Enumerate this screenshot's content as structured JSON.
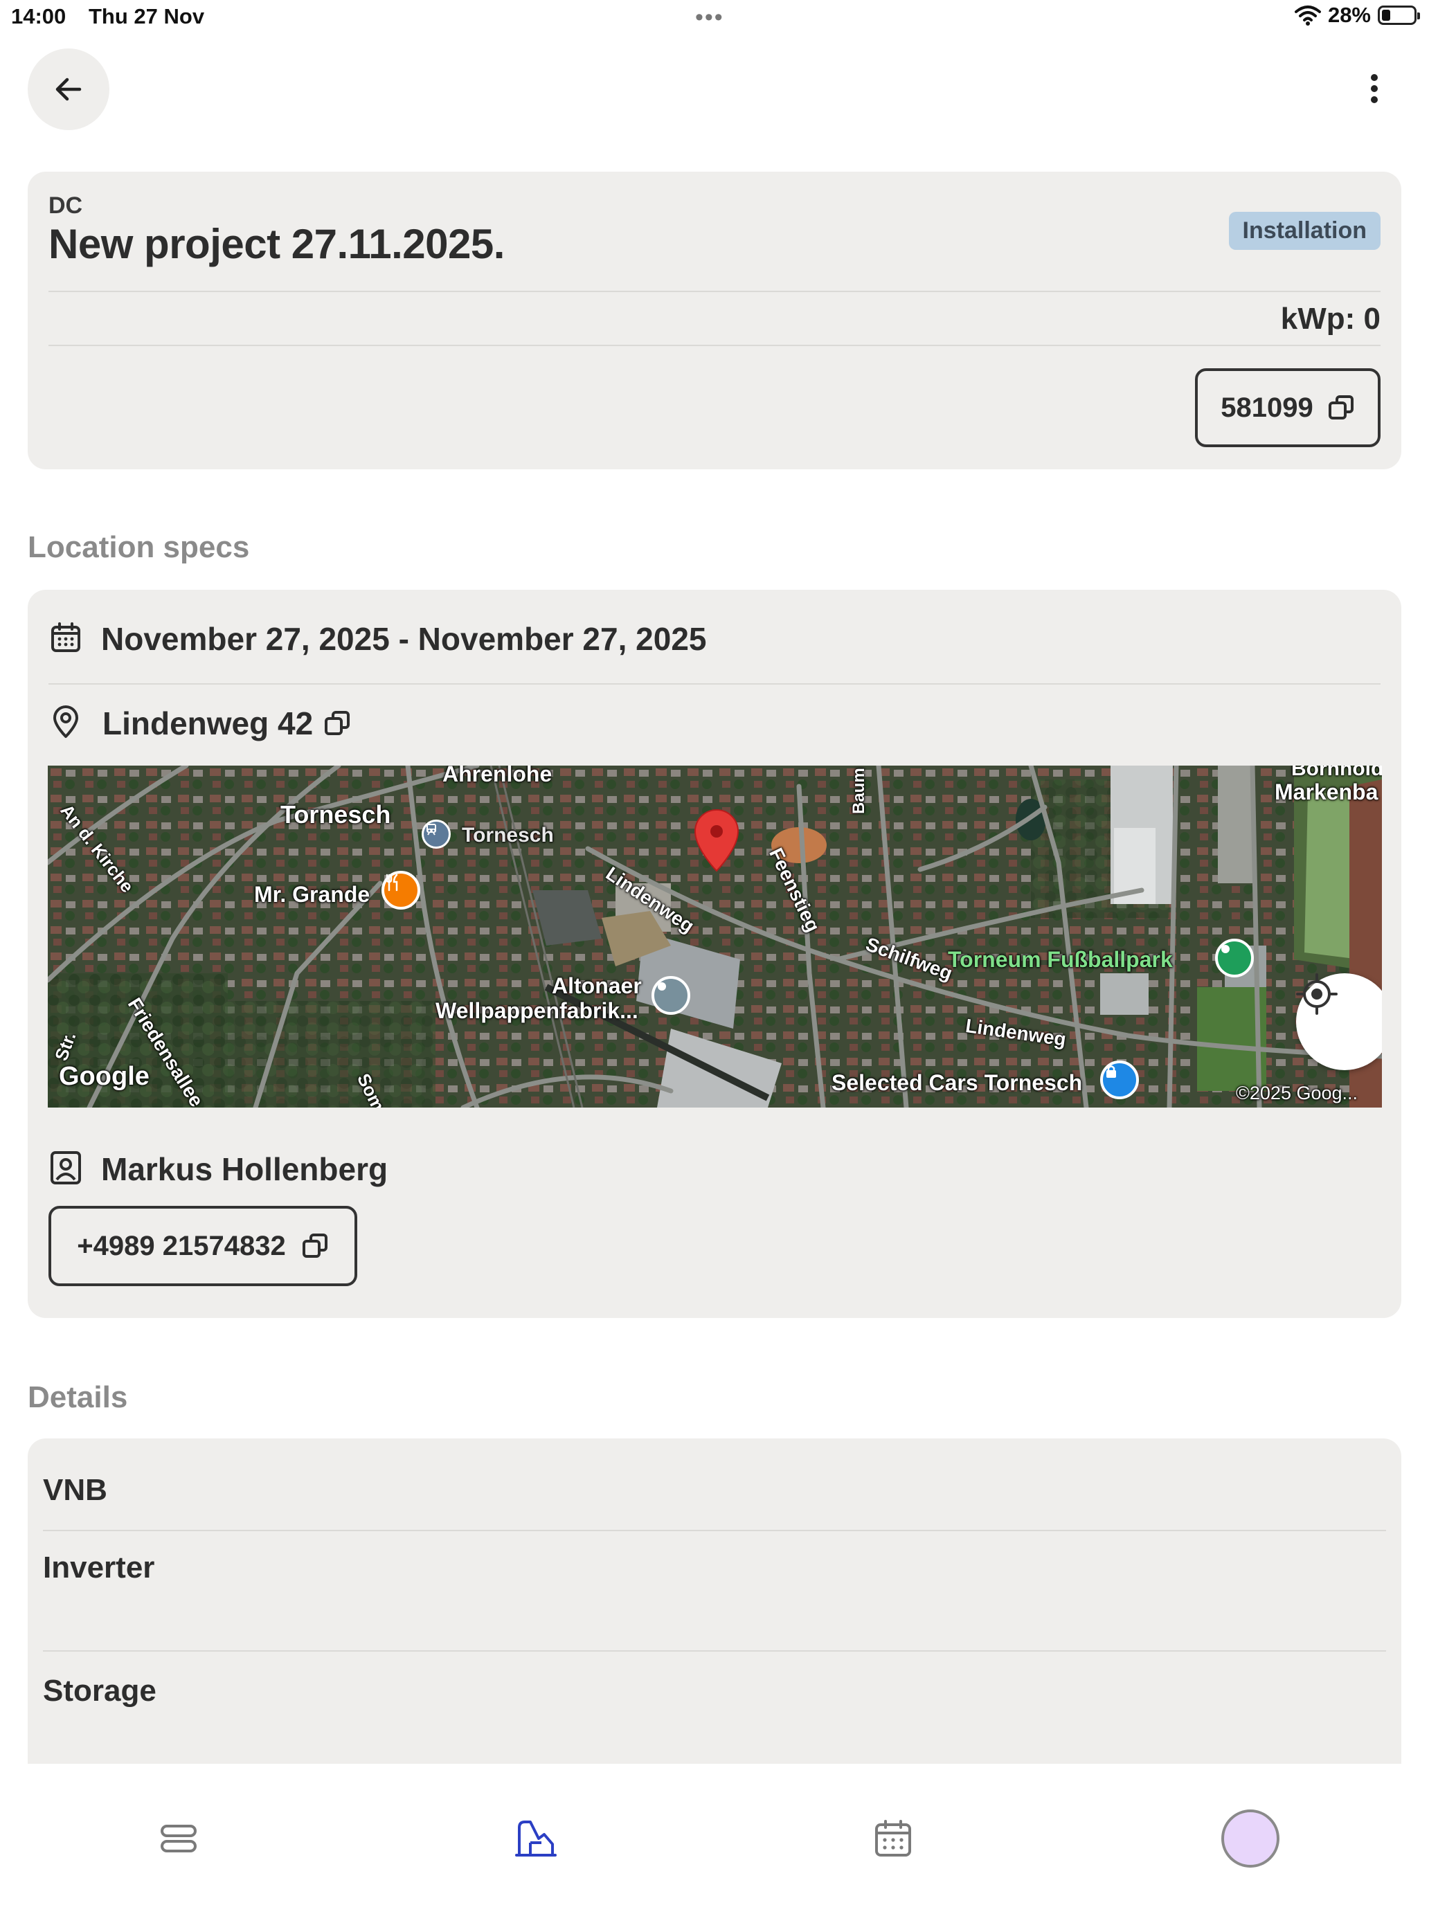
{
  "status_bar": {
    "time": "14:00",
    "date": "Thu 27 Nov",
    "battery": "28%",
    "battery_level": 0.28
  },
  "icons": {
    "back": "arrow-left-icon",
    "more": "more-vertical-icon",
    "copy": "copy-icon",
    "calendar": "calendar-icon",
    "location": "map-pin-icon",
    "contact": "contact-card-icon",
    "locate": "my-location-icon"
  },
  "project": {
    "type": "DC",
    "title": "New project 27.11.2025.",
    "status": "Installation",
    "kwp": "kWp: 0",
    "id": "581099"
  },
  "location": {
    "section_title": "Location specs",
    "date_range": "November 27, 2025 - November 27, 2025",
    "address": "Lindenweg 42",
    "contact_name": "Markus Hollenberg",
    "phone": "+4989 21574832"
  },
  "map": {
    "labels": {
      "ahrenlohe": "Ahrenlohe",
      "an_d_kirche": "An d. Kirche",
      "tornesch_area": "Tornesch",
      "tornesch_station": "Tornesch",
      "mr_grande": "Mr. Grande",
      "lindenweg_1": "Lindenweg",
      "feenstieg": "Feenstieg",
      "baum": "Baum",
      "schilfweg": "Schilfweg",
      "torneum": "Torneum Fußballpark",
      "lindenweg_2": "Lindenweg",
      "altonaer_1": "Altonaer",
      "altonaer_2": "Wellpappenfabrik...",
      "friedensallee": "Friedensallee",
      "str": "Str.",
      "som": "Som",
      "selected_cars": "Selected Cars Tornesch",
      "bornhold": "Bornhold",
      "markenba": "Markenba",
      "google": "Google",
      "copyright": "©2025 Goog..."
    },
    "poi_colors": {
      "pin": "#e53935",
      "restaurant": "#f57c00",
      "transit": "#5c7a99",
      "factory": "#78909c",
      "park": "#1e9e5a",
      "shop": "#1e88e5"
    }
  },
  "details": {
    "section_title": "Details",
    "rows": [
      "VNB",
      "Inverter",
      "Storage"
    ]
  },
  "nav": {
    "items": [
      "list-icon",
      "home-icon",
      "calendar-icon",
      "avatar"
    ],
    "active": "home-icon",
    "active_color": "#2b3fc4"
  }
}
